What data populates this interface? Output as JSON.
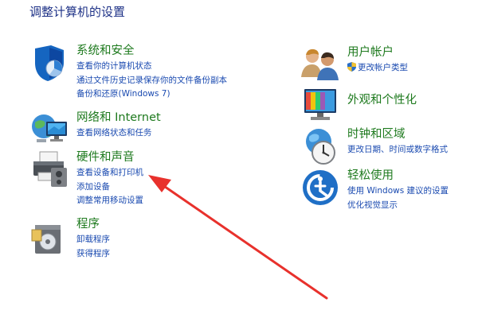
{
  "page_title": "调整计算机的设置",
  "left": [
    {
      "title": "系统和安全",
      "links": [
        "查看你的计算机状态",
        "通过文件历史记录保存你的文件备份副本",
        "备份和还原(Windows 7)"
      ]
    },
    {
      "title": "网络和 Internet",
      "links": [
        "查看网络状态和任务"
      ]
    },
    {
      "title": "硬件和声音",
      "links": [
        "查看设备和打印机",
        "添加设备",
        "调整常用移动设置"
      ]
    },
    {
      "title": "程序",
      "links": [
        "卸载程序",
        "获得程序"
      ]
    }
  ],
  "right": [
    {
      "title": "用户帐户",
      "links": [
        "更改帐户类型"
      ]
    },
    {
      "title": "外观和个性化",
      "links": []
    },
    {
      "title": "时钟和区域",
      "links": [
        "更改日期、时间或数字格式"
      ]
    },
    {
      "title": "轻松使用",
      "links": [
        "使用 Windows 建议的设置",
        "优化视觉显示"
      ]
    }
  ],
  "colors": {
    "category_title": "#1e7a1e",
    "link": "#1a4ab0",
    "annotation_arrow": "#e8312c"
  }
}
